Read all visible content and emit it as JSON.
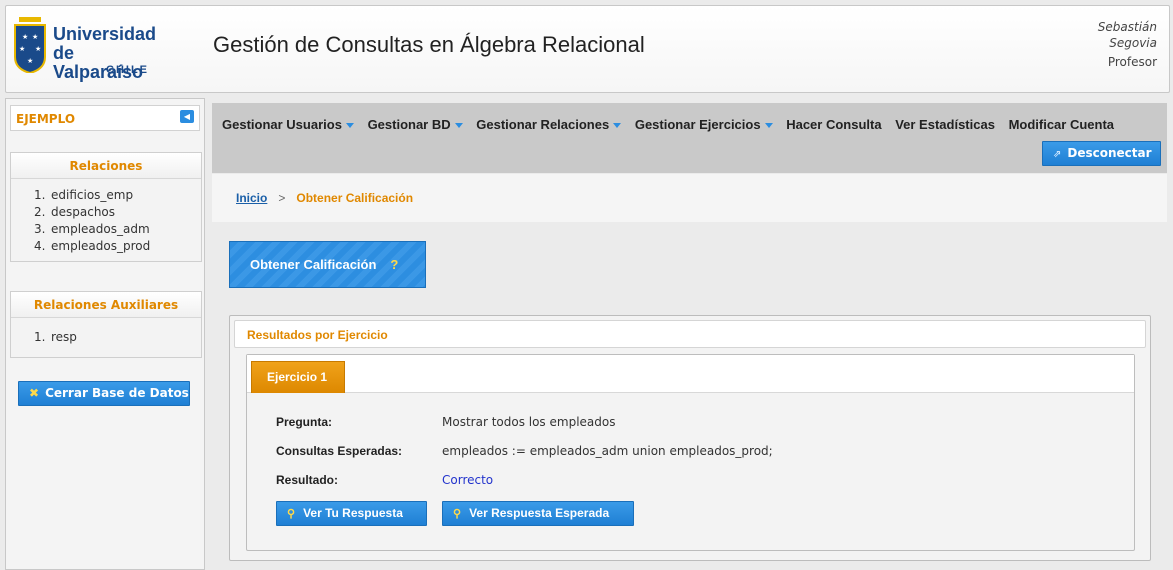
{
  "header": {
    "logo_line1": "Universidad",
    "logo_line2": "de Valparaíso",
    "logo_line3": "CHILE",
    "app_title": "Gestión de Consultas en Álgebra Relacional",
    "user_first": "Sebastián",
    "user_last": "Segovia",
    "user_role": "Profesor"
  },
  "sidebar": {
    "db_name": "EJEMPLO",
    "relations_title": "Relaciones",
    "relations": [
      {
        "num": "1.",
        "name": "edificios_emp"
      },
      {
        "num": "2.",
        "name": "despachos"
      },
      {
        "num": "3.",
        "name": "empleados_adm"
      },
      {
        "num": "4.",
        "name": "empleados_prod"
      }
    ],
    "aux_title": "Relaciones Auxiliares",
    "aux_relations": [
      {
        "num": "1.",
        "name": "resp"
      }
    ],
    "close_db_label": "Cerrar Base de Datos"
  },
  "nav": {
    "items": [
      {
        "label": "Gestionar Usuarios"
      },
      {
        "label": "Gestionar BD"
      },
      {
        "label": "Gestionar Relaciones"
      },
      {
        "label": "Gestionar Ejercicios"
      },
      {
        "label": "Hacer Consulta"
      },
      {
        "label": "Ver Estadísticas"
      },
      {
        "label": "Modificar Cuenta"
      }
    ],
    "logout_label": "Desconectar"
  },
  "breadcrumb": {
    "home": "Inicio",
    "separator": ">",
    "current": "Obtener Calificación"
  },
  "main": {
    "action_label": "Obtener Calificación",
    "action_help": "?",
    "results_title": "Resultados por Ejercicio",
    "exercise_tab": "Ejercicio 1",
    "question_label": "Pregunta:",
    "question_value": "Mostrar todos los empleados",
    "expected_label": "Consultas Esperadas:",
    "expected_value": "empleados := empleados_adm union empleados_prod;",
    "result_label": "Resultado:",
    "result_value": "Correcto",
    "btn_your_answer": "Ver Tu Respuesta",
    "btn_expected_answer": "Ver Respuesta Esperada"
  },
  "colors": {
    "accent_orange": "#e08800",
    "accent_blue": "#2b8de0",
    "link_blue": "#1a5fa8"
  }
}
